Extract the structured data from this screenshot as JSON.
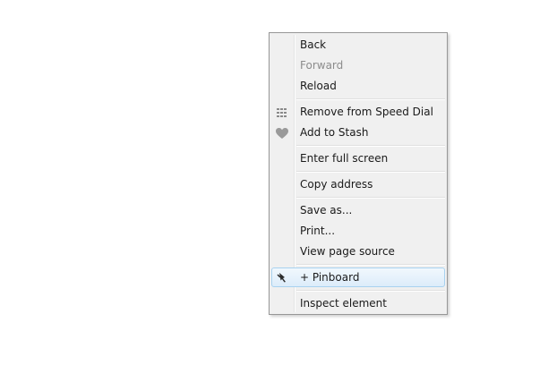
{
  "context_menu": {
    "items": [
      {
        "label": "Back",
        "enabled": true
      },
      {
        "label": "Forward",
        "enabled": false
      },
      {
        "label": "Reload",
        "enabled": true
      },
      {
        "label": "Remove from Speed Dial",
        "icon": "speed-dial-grid-icon",
        "enabled": true
      },
      {
        "label": "Add to Stash",
        "icon": "heart-icon",
        "enabled": true
      },
      {
        "label": "Enter full screen",
        "enabled": true
      },
      {
        "label": "Copy address",
        "enabled": true
      },
      {
        "label": "Save as...",
        "enabled": true
      },
      {
        "label": "Print...",
        "enabled": true
      },
      {
        "label": "View page source",
        "enabled": true
      },
      {
        "label": "+ Pinboard",
        "icon": "pushpin-icon",
        "enabled": true,
        "highlighted": true
      },
      {
        "label": "Inspect element",
        "enabled": true
      }
    ]
  },
  "colors": {
    "menu_background": "#f0f0f0",
    "menu_border": "#979797",
    "disabled_text": "#8c8c8c",
    "highlight_border": "#a8d2f0"
  }
}
